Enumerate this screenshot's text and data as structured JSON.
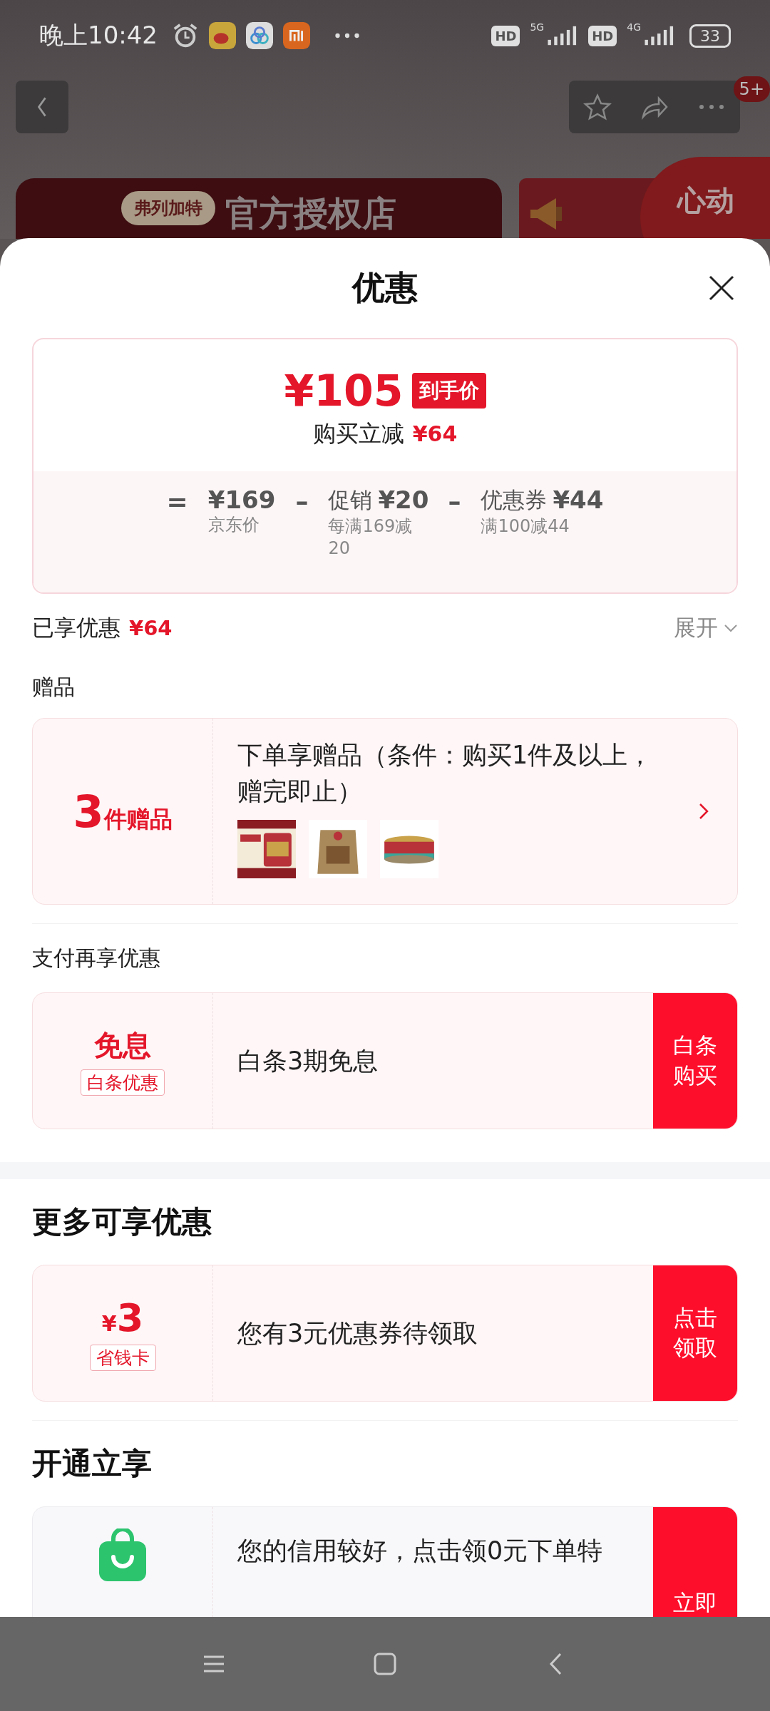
{
  "status_bar": {
    "time": "晚上10:42",
    "network_1": "5G",
    "network_2": "4G",
    "hd_1": "HD",
    "hd_2": "HD",
    "battery": "33"
  },
  "top_nav": {
    "badge": "5+"
  },
  "store_banner": {
    "logo": "弗列加特",
    "title": "官方授权店",
    "promo": "心动"
  },
  "sheet": {
    "title": "优惠"
  },
  "price": {
    "amount": "¥105",
    "tag": "到手价",
    "saving_label": "购买立减",
    "saving": "¥64",
    "breakdown": [
      {
        "op": "=",
        "value": "¥169",
        "note": "京东价"
      },
      {
        "op": "–",
        "label": "促销",
        "value": "¥20",
        "note": "每满169减20"
      },
      {
        "op": "–",
        "label": "优惠券",
        "value": "¥44",
        "note": "满100减44"
      }
    ]
  },
  "enjoyed": {
    "label": "已享优惠",
    "amount": "¥64",
    "expand": "展开"
  },
  "sections": [
    {
      "kind": "minor",
      "title": "赠品",
      "cards": [
        {
          "kind": "gift",
          "count": "3",
          "unit": "件赠品",
          "text": "下单享赠品（条件：购买1件及以上，赠完即止）"
        }
      ]
    },
    {
      "kind": "minor",
      "title": "支付再享优惠",
      "cards": [
        {
          "kind": "pay",
          "badge_title": "免息",
          "badge_tag": "白条优惠",
          "text": "白条3期免息",
          "action": "白条购买"
        }
      ]
    },
    {
      "kind": "major",
      "title": "更多可享优惠",
      "cards": [
        {
          "kind": "coupon",
          "currency": "¥",
          "value": "3",
          "badge_tag": "省钱卡",
          "text": "您有3元优惠券待领取",
          "action": "点击领取"
        }
      ]
    },
    {
      "kind": "major",
      "title": "开通立享",
      "cards": [
        {
          "kind": "service",
          "text": "您的信用较好，点击领0元下单特",
          "action": "立即"
        }
      ]
    }
  ]
}
